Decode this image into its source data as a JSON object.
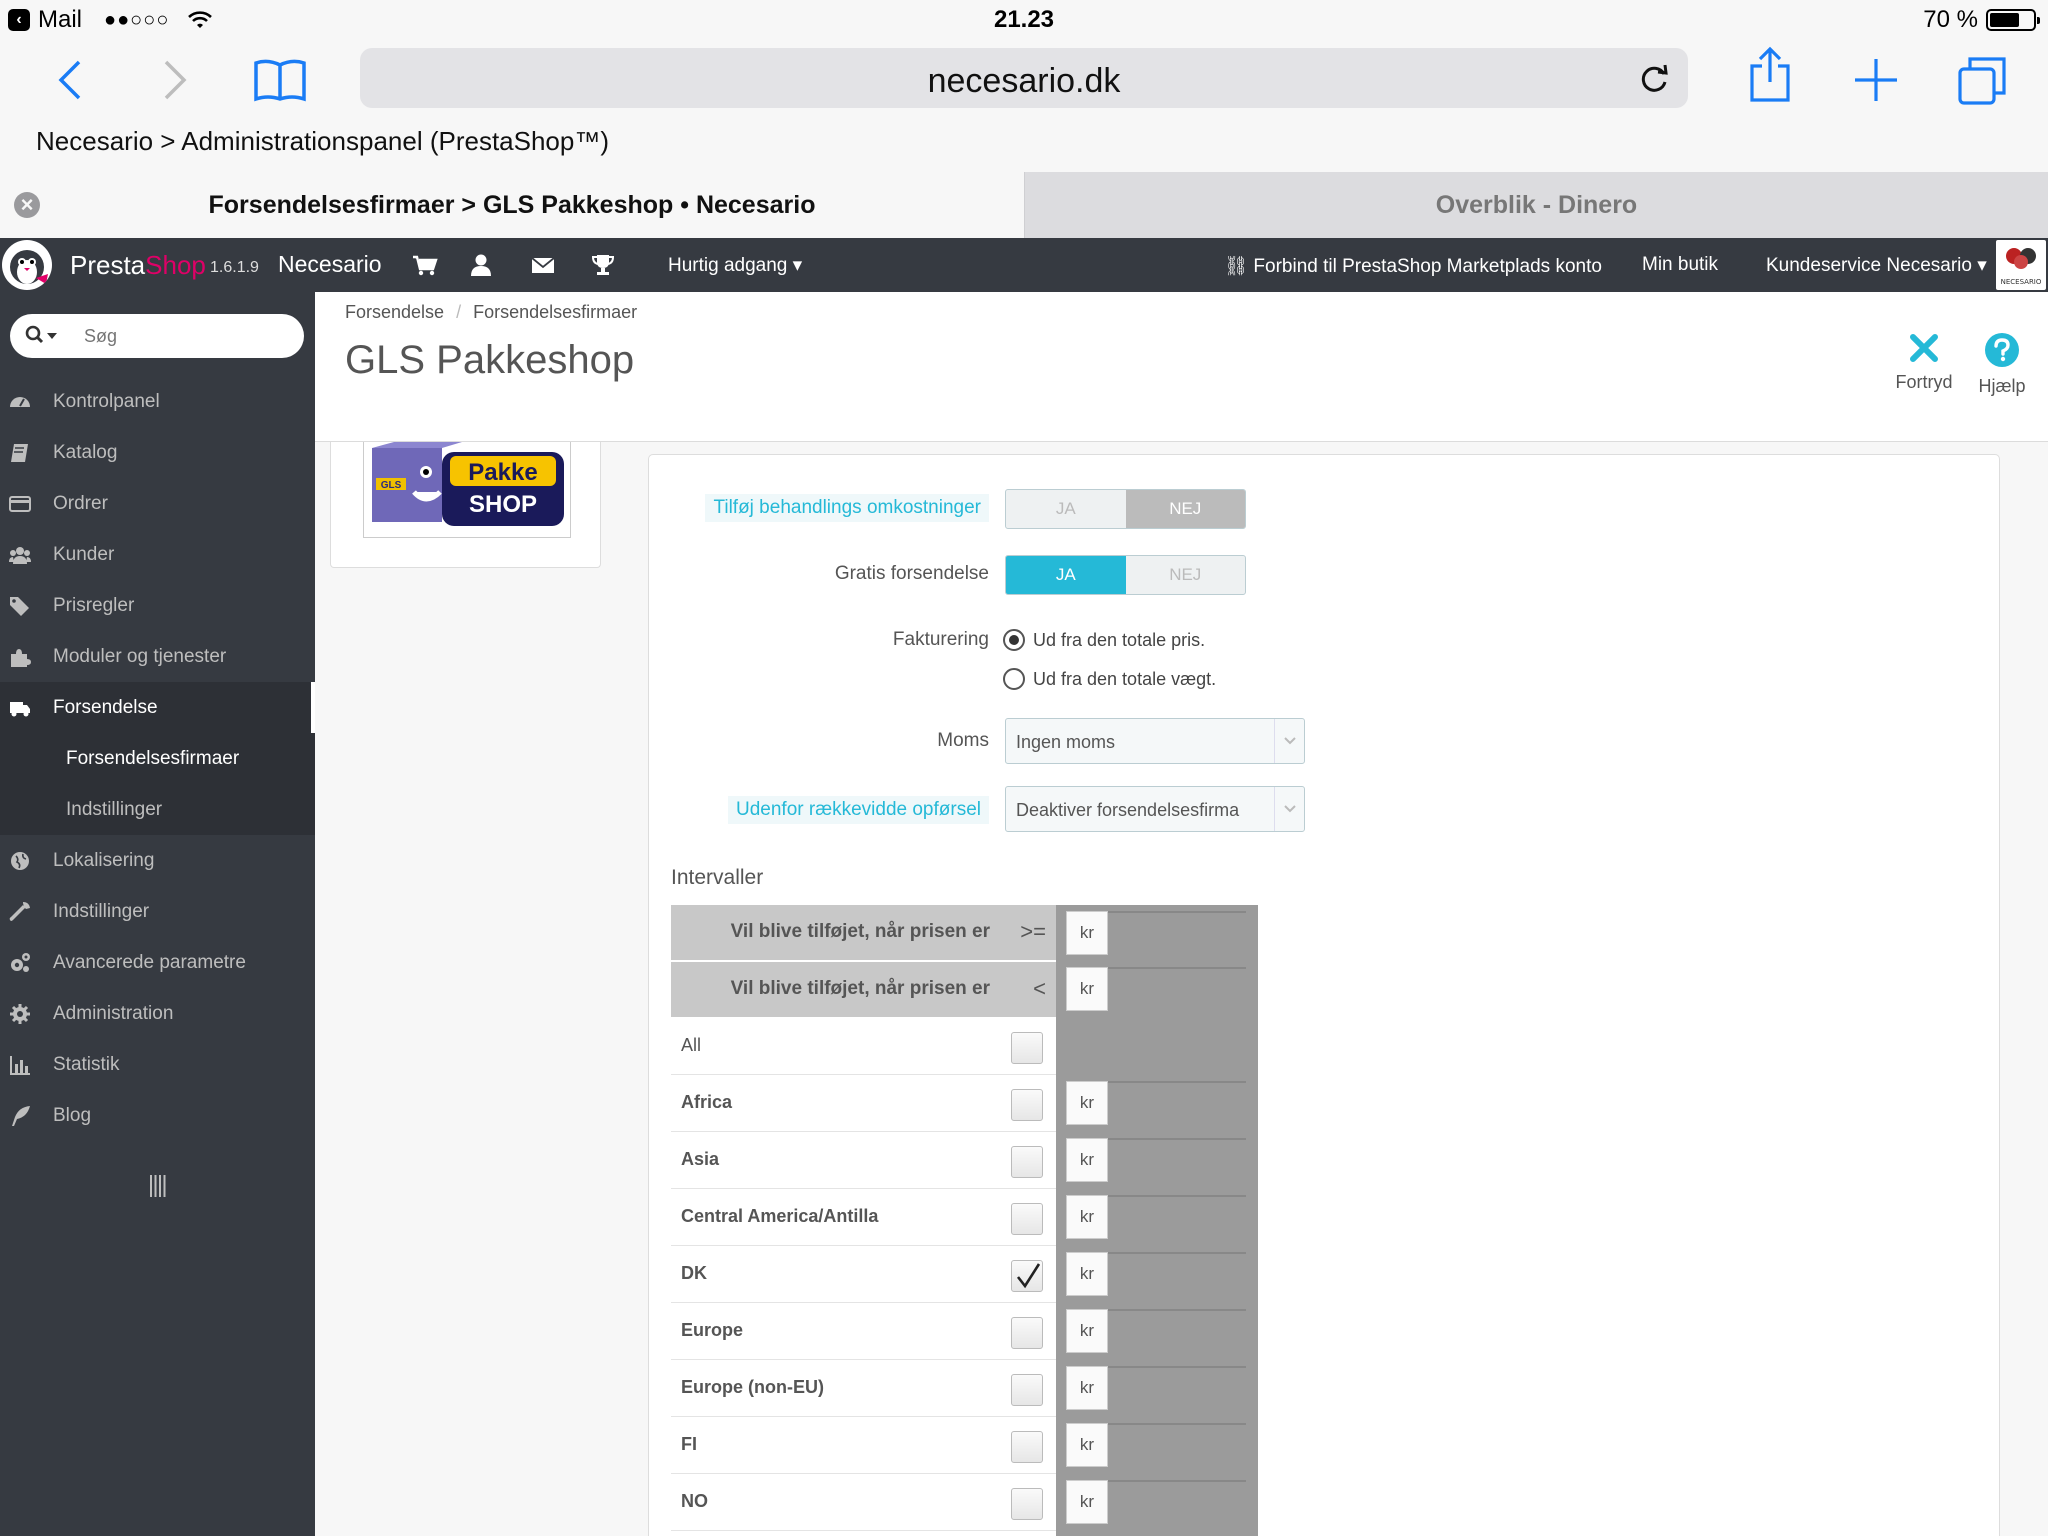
{
  "statusbar": {
    "back_app": "Mail",
    "time": "21.23",
    "battery": "70 %",
    "battery_level": 0.7
  },
  "browser": {
    "url": "necesario.dk",
    "page_title": "Necesario > Administrationspanel (PrestaShop™)",
    "tabs": [
      {
        "label": "Forsendelsesfirmaer > GLS Pakkeshop • Necesario"
      },
      {
        "label": "Overblik - Dinero"
      }
    ]
  },
  "header": {
    "brand_a": "Presta",
    "brand_b": "Shop",
    "version": "1.6.1.9",
    "shop_name": "Necesario",
    "quick_access": "Hurtig adgang",
    "marketplace": "Forbind til PrestaShop Marketplads konto",
    "my_shop": "Min butik",
    "customer_service": "Kundeservice Necesario",
    "avatar_text": "NECESARIO"
  },
  "sidebar": {
    "search_placeholder": "Søg",
    "items": [
      {
        "label": "Kontrolpanel",
        "icon": "dashboard-icon"
      },
      {
        "label": "Katalog",
        "icon": "book-icon"
      },
      {
        "label": "Ordrer",
        "icon": "credit-card-icon"
      },
      {
        "label": "Kunder",
        "icon": "users-icon"
      },
      {
        "label": "Prisregler",
        "icon": "tags-icon"
      },
      {
        "label": "Moduler og tjenester",
        "icon": "puzzle-icon"
      },
      {
        "label": "Forsendelse",
        "icon": "truck-icon"
      },
      {
        "label": "Lokalisering",
        "icon": "globe-icon"
      },
      {
        "label": "Indstillinger",
        "icon": "wrench-icon"
      },
      {
        "label": "Avancerede parametre",
        "icon": "cogs-icon"
      },
      {
        "label": "Administration",
        "icon": "gear-icon"
      },
      {
        "label": "Statistik",
        "icon": "bar-chart-icon"
      },
      {
        "label": "Blog",
        "icon": "feather-icon"
      }
    ],
    "sub_items": [
      {
        "label": "Forsendelsesfirmaer"
      },
      {
        "label": "Indstillinger"
      }
    ]
  },
  "page": {
    "breadcrumb": [
      "Forsendelse",
      "Forsendelsesfirmaer"
    ],
    "breadcrumb_sep": "/",
    "title": "GLS Pakkeshop",
    "cancel_label": "Fortryd",
    "help_label": "Hjælp"
  },
  "logo": {
    "line1": "Pakke",
    "line2": "SHOP",
    "gls": "GLS"
  },
  "form": {
    "handling": {
      "label": "Tilføj behandlings omkostninger",
      "yes": "JA",
      "no": "NEJ",
      "value": "NEJ"
    },
    "free_shipping": {
      "label": "Gratis forsendelse",
      "yes": "JA",
      "no": "NEJ",
      "value": "JA"
    },
    "billing": {
      "label": "Fakturering",
      "options": [
        "Ud fra den totale pris.",
        "Ud fra den totale vægt."
      ],
      "selected": "Ud fra den totale pris."
    },
    "tax": {
      "label": "Moms",
      "value": "Ingen moms"
    },
    "out_of_range": {
      "label": "Udenfor rækkevidde opførsel",
      "value": "Deaktiver forsendelsesfirma"
    },
    "intervals": {
      "title": "Intervaller",
      "currency": "kr",
      "range_rows": [
        {
          "label": "Vil blive tilføjet, når prisen er",
          "op": ">="
        },
        {
          "label": "Vil blive tilføjet, når prisen er",
          "op": "<"
        }
      ],
      "all_label": "All",
      "zones": [
        {
          "name": "Africa",
          "checked": false
        },
        {
          "name": "Asia",
          "checked": false
        },
        {
          "name": "Central America/Antilla",
          "checked": false
        },
        {
          "name": "DK",
          "checked": true
        },
        {
          "name": "Europe",
          "checked": false
        },
        {
          "name": "Europe (non-EU)",
          "checked": false
        },
        {
          "name": "FI",
          "checked": false
        },
        {
          "name": "NO",
          "checked": false
        }
      ]
    }
  }
}
